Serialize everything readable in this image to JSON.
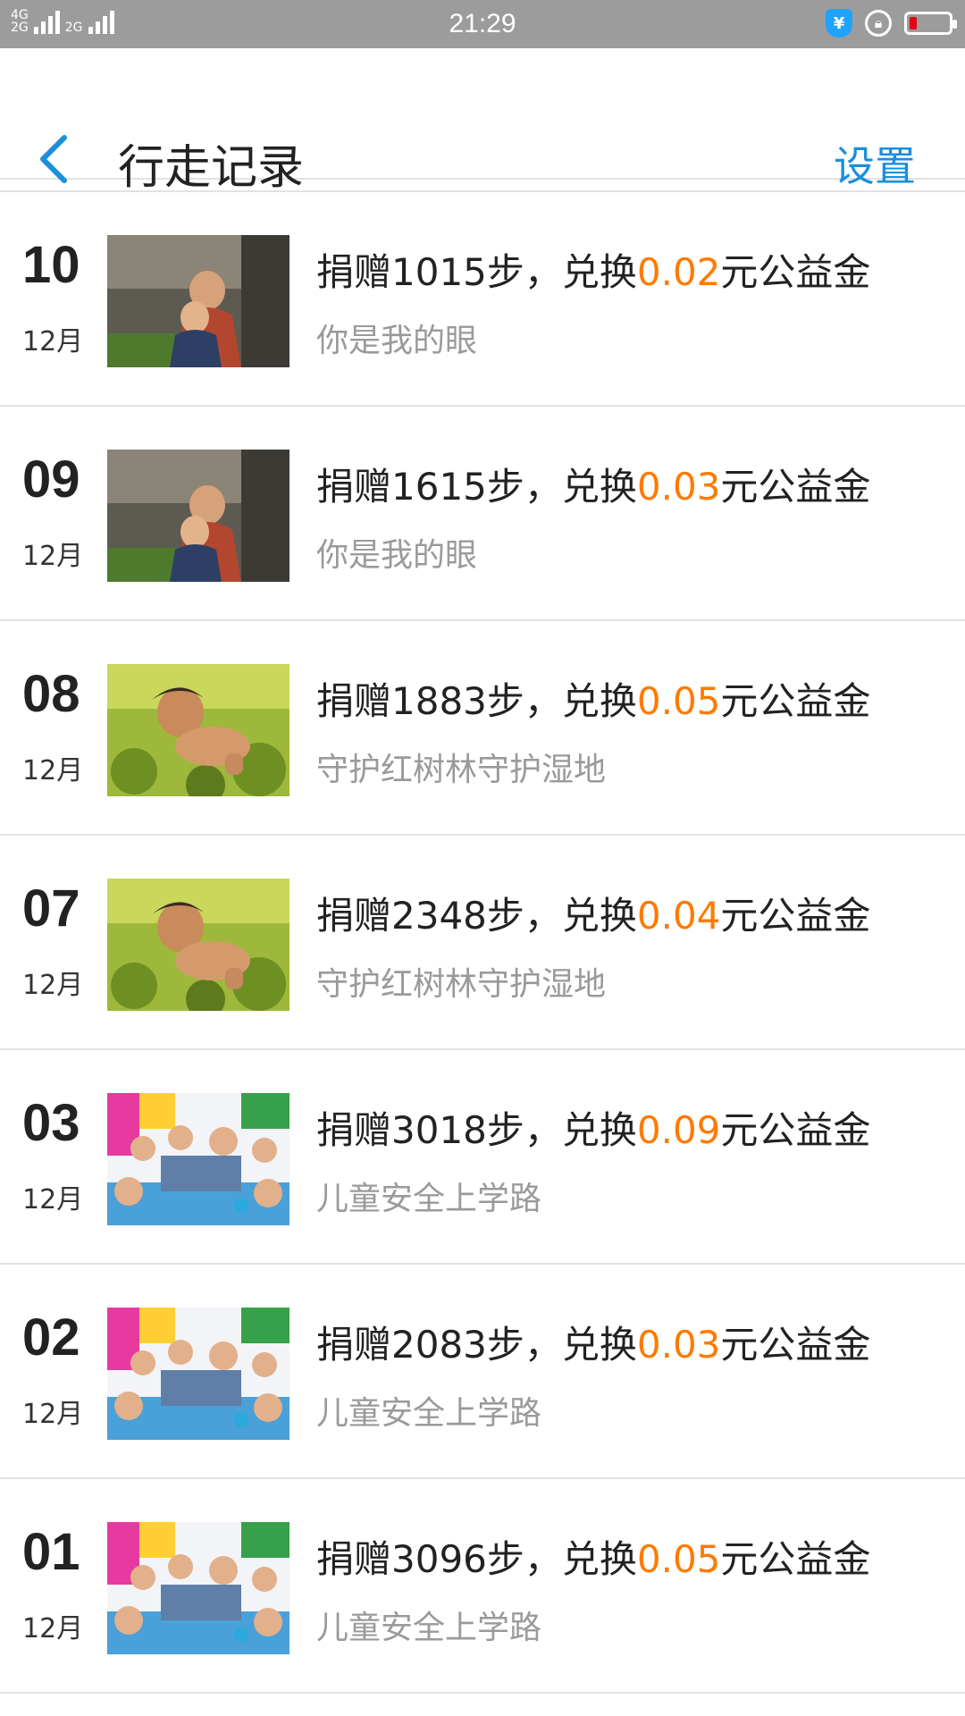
{
  "status_bar": {
    "time": "21:29",
    "network_left": "4G",
    "network_left2": "2G",
    "network_right": "2G"
  },
  "header": {
    "title": "行走记录",
    "settings_label": "设置"
  },
  "records": [
    {
      "day": "10",
      "month": "12月",
      "prefix": "捐赠1015步，兑换",
      "amount": "0.02",
      "suffix": "元公益金",
      "project": "你是我的眼",
      "image": "eyes"
    },
    {
      "day": "09",
      "month": "12月",
      "prefix": "捐赠1615步，兑换",
      "amount": "0.03",
      "suffix": "元公益金",
      "project": "你是我的眼",
      "image": "eyes"
    },
    {
      "day": "08",
      "month": "12月",
      "prefix": "捐赠1883步，兑换",
      "amount": "0.05",
      "suffix": "元公益金",
      "project": "守护红树林守护湿地",
      "image": "mangrove"
    },
    {
      "day": "07",
      "month": "12月",
      "prefix": "捐赠2348步，兑换",
      "amount": "0.04",
      "suffix": "元公益金",
      "project": "守护红树林守护湿地",
      "image": "mangrove"
    },
    {
      "day": "03",
      "month": "12月",
      "prefix": "捐赠3018步，兑换",
      "amount": "0.09",
      "suffix": "元公益金",
      "project": "儿童安全上学路",
      "image": "school"
    },
    {
      "day": "02",
      "month": "12月",
      "prefix": "捐赠2083步，兑换",
      "amount": "0.03",
      "suffix": "元公益金",
      "project": "儿童安全上学路",
      "image": "school"
    },
    {
      "day": "01",
      "month": "12月",
      "prefix": "捐赠3096步，兑换",
      "amount": "0.05",
      "suffix": "元公益金",
      "project": "儿童安全上学路",
      "image": "school"
    }
  ],
  "colors": {
    "accent": "#1a8fdc",
    "amount": "#ff7a00",
    "secondary_text": "#9a9a9a",
    "status_bar": "#9c9c9c"
  }
}
